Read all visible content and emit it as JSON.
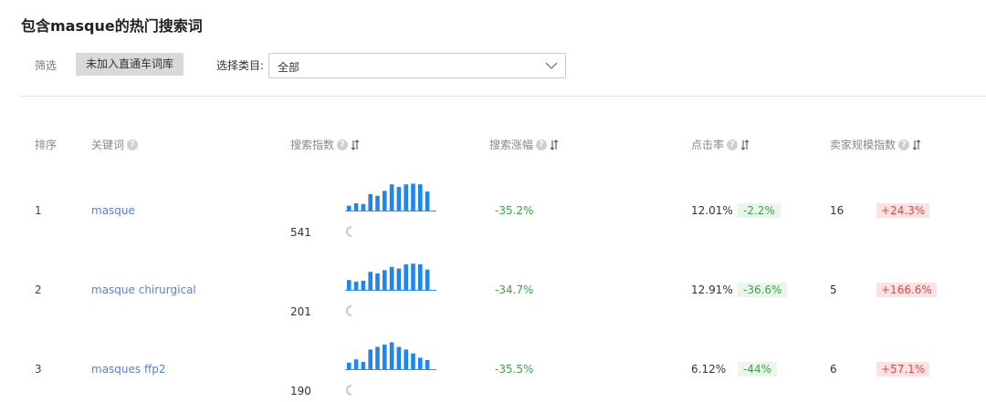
{
  "header": {
    "title": "包含masque的热门搜索词"
  },
  "filters": {
    "label": "筛选",
    "chip": "未加入直通车词库",
    "category_label": "选择类目:",
    "category_value": "全部"
  },
  "table": {
    "columns": {
      "rank": "排序",
      "keyword": "关键词",
      "search_index": "搜索指数",
      "search_growth": "搜索涨幅",
      "ctr": "点击率",
      "seller_index": "卖家规模指数"
    },
    "rows": [
      {
        "rank": "1",
        "keyword": "masque",
        "search_index": "541",
        "trend": [
          0.15,
          0.22,
          0.2,
          0.5,
          0.45,
          0.6,
          0.8,
          0.72,
          0.8,
          0.82,
          0.8,
          0.58
        ],
        "search_growth": "-35.2%",
        "ctr": "12.01%",
        "ctr_change": "-2.2%",
        "seller_index": "16",
        "seller_change": "+24.3%"
      },
      {
        "rank": "2",
        "keyword": "masque chirurgical",
        "search_index": "201",
        "trend": [
          0.3,
          0.25,
          0.28,
          0.55,
          0.5,
          0.6,
          0.7,
          0.65,
          0.78,
          0.8,
          0.78,
          0.62
        ],
        "search_growth": "-34.7%",
        "ctr": "12.91%",
        "ctr_change": "-36.6%",
        "seller_index": "5",
        "seller_change": "+166.6%"
      },
      {
        "rank": "3",
        "keyword": "masques ffp2",
        "search_index": "190",
        "trend": [
          0.2,
          0.3,
          0.22,
          0.6,
          0.68,
          0.75,
          0.82,
          0.68,
          0.6,
          0.48,
          0.35,
          0.28
        ],
        "search_growth": "-35.5%",
        "ctr": "6.12%",
        "ctr_change": "-44%",
        "seller_index": "6",
        "seller_change": "+57.1%"
      }
    ]
  },
  "colors": {
    "bar": "#1f86f0",
    "axis": "#3a8ee8",
    "spinner": "#cccccc"
  }
}
